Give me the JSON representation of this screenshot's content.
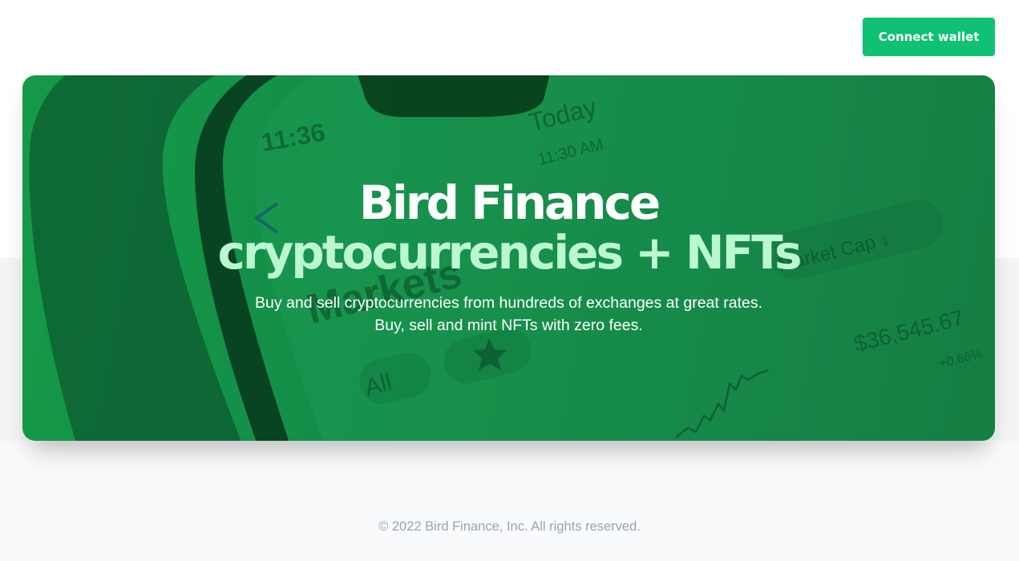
{
  "header": {
    "connect_wallet_label": "Connect wallet"
  },
  "hero": {
    "title_line1": "Bird Finance",
    "title_line2": "cryptocurrencies + NFTs",
    "subtitle_line1": "Buy and sell cryptocurrencies from hundreds of exchanges at great rates.",
    "subtitle_line2": "Buy, sell and mint NFTs with zero fees.",
    "background_image": {
      "icons": [
        "phone-illustration",
        "star-icon",
        "chevron-left-icon",
        "sparkline-chart"
      ],
      "clock": "11:36",
      "date_label": "Today",
      "time_label": "11:30 AM",
      "heading": "Markets",
      "filter_all": "All",
      "sort_label": "Market Cap ↓",
      "price": "$36,545.67",
      "change": "+0.66%"
    }
  },
  "footer": {
    "copyright": "© 2022 Bird Finance, Inc. All rights reserved."
  },
  "colors": {
    "accent": "#10c074",
    "hero_green": "#15924a",
    "title_highlight": "#bbf7d0",
    "footer_text": "#9ca3af"
  }
}
